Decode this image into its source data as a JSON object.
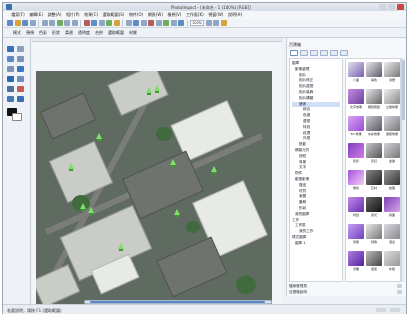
{
  "window": {
    "title": "PhotoImpact - [未命名 - 1 (100%) [RGB]]"
  },
  "menu": [
    "檔案(F)",
    "編輯(E)",
    "調整(A)",
    "相片(P)",
    "效果(C)",
    "選取範圍(S)",
    "物件(O)",
    "網頁(W)",
    "檢視(V)",
    "工作區(K)",
    "視窗(W)",
    "說明(H)"
  ],
  "toolbar": {
    "zoom_value": "100%"
  },
  "options_bar": [
    "模式",
    "預視",
    "色彩",
    "形狀",
    "柔邊",
    "透明度",
    "合併",
    "選取範圍",
    "材質"
  ],
  "right_panel": {
    "title": "百寶箱",
    "tree": [
      {
        "label": "圖庫",
        "level": 0
      },
      {
        "label": "影像處理",
        "level": 1
      },
      {
        "label": "相片",
        "level": 2
      },
      {
        "label": "相片修正",
        "level": 2
      },
      {
        "label": "相片邊框",
        "level": 2
      },
      {
        "label": "相片裝飾",
        "level": 2
      },
      {
        "label": "相片構圖",
        "level": 2
      },
      {
        "label": "藝術",
        "level": 2
      },
      {
        "label": "綜合",
        "level": 3
      },
      {
        "label": "色調",
        "level": 3
      },
      {
        "label": "邊框",
        "level": 3
      },
      {
        "label": "特效",
        "level": 3
      },
      {
        "label": "紋理",
        "level": 3
      },
      {
        "label": "外框",
        "level": 3
      },
      {
        "label": "陰影",
        "level": 2
      },
      {
        "label": "網頁元件",
        "level": 1
      },
      {
        "label": "按鈕",
        "level": 2
      },
      {
        "label": "背景",
        "level": 2
      },
      {
        "label": "文字",
        "level": 2
      },
      {
        "label": "物件",
        "level": 1
      },
      {
        "label": "動態影像",
        "level": 1
      },
      {
        "label": "路徑",
        "level": 2
      },
      {
        "label": "材質",
        "level": 2
      },
      {
        "label": "漸層",
        "level": 2
      },
      {
        "label": "筆刷",
        "level": 2
      },
      {
        "label": "形狀",
        "level": 2
      },
      {
        "label": "我的圖庫",
        "level": 1
      },
      {
        "label": "工作",
        "level": 0
      },
      {
        "label": "工作區",
        "level": 1
      },
      {
        "label": "我的工作",
        "level": 2
      },
      {
        "label": "樣式圖庫",
        "level": 0
      },
      {
        "label": "圖庫 1",
        "level": 1
      }
    ],
    "thumbnails": [
      {
        "label": "介面",
        "color1": "#e2dff0",
        "color2": "#7a5fb0"
      },
      {
        "label": "填色",
        "color1": "#e8e6ee",
        "color2": "#5a5a6a"
      },
      {
        "label": "漸層",
        "color1": "#efeef0",
        "color2": "#777"
      },
      {
        "label": "文字效果",
        "color1": "#c58de0",
        "color2": "#6a3fa0"
      },
      {
        "label": "網頁按鈕",
        "color1": "#e6e4ea",
        "color2": "#666"
      },
      {
        "label": "立體效果",
        "color1": "#f0f0f2",
        "color2": "#888"
      },
      {
        "label": "3D 效果",
        "color1": "#d9a5f0",
        "color2": "#9a4ad8"
      },
      {
        "label": "水彩效果",
        "color1": "#c5c6ce",
        "color2": "#5a5a66"
      },
      {
        "label": "邊框效果",
        "color1": "#d8d6e0",
        "color2": "#777"
      },
      {
        "label": "陰影",
        "color1": "#7a3fc0",
        "color2": "#d77ae8"
      },
      {
        "label": "霓虹",
        "color1": "#c8c5cc",
        "color2": "#555"
      },
      {
        "label": "金屬",
        "color1": "#d4d3d8",
        "color2": "#777"
      },
      {
        "label": "玻璃",
        "color1": "#a64fdf",
        "color2": "#f2d0f5"
      },
      {
        "label": "石材",
        "color1": "#888",
        "color2": "#222"
      },
      {
        "label": "紋理",
        "color1": "#999",
        "color2": "#333"
      },
      {
        "label": "材質",
        "color1": "#c18ae8",
        "color2": "#6830b0"
      },
      {
        "label": "亮光",
        "color1": "#666",
        "color2": "#111"
      },
      {
        "label": "霧面",
        "color1": "#7a3fb0",
        "color2": "#d8a5ec"
      },
      {
        "label": "筆刷",
        "color1": "#c9a0f0",
        "color2": "#6a40c0"
      },
      {
        "label": "特殊",
        "color1": "#e7e6ea",
        "color2": "#777"
      },
      {
        "label": "混合",
        "color1": "#dcd8e4",
        "color2": "#888"
      },
      {
        "label": "浮雕",
        "color1": "#b080e0",
        "color2": "#5020a0"
      },
      {
        "label": "造型",
        "color1": "#bbb",
        "color2": "#444"
      },
      {
        "label": "外框",
        "color1": "#ddd",
        "color2": "#999"
      }
    ],
    "footer1": "檔案管理員",
    "footer2": "百寶箱說明"
  },
  "status": {
    "text": "若要說明，請按 F1 (選取範圍)"
  }
}
